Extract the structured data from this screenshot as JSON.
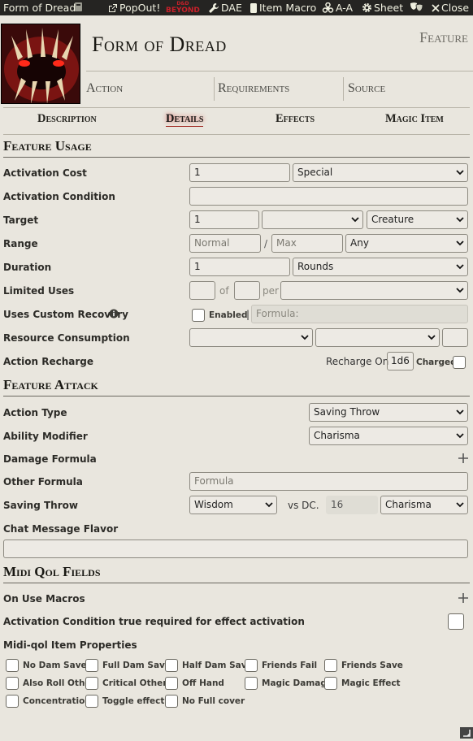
{
  "window": {
    "title": "Form of Dread",
    "buttons": {
      "popout": "PopOut!",
      "dndbeyond_top": "D&D",
      "dndbeyond_bottom": "BEYOND",
      "dae": "DAE",
      "item_macro": "Item Macro",
      "aa": "A-A",
      "sheet": "Sheet",
      "close": "Close"
    }
  },
  "header": {
    "name": "Form of Dread",
    "type": "Feature",
    "summary": {
      "action": "Action",
      "requirements": "Requirements",
      "source": "Source"
    }
  },
  "tabs": {
    "description": "Description",
    "details": "Details",
    "effects": "Effects",
    "magic_item": "Magic Item",
    "active": "details"
  },
  "feature_usage": {
    "heading": "Feature Usage",
    "activation_cost": {
      "label": "Activation Cost",
      "value": "1",
      "type": "Special"
    },
    "activation_condition": {
      "label": "Activation Condition",
      "value": ""
    },
    "target": {
      "label": "Target",
      "value": "1",
      "units": "",
      "type": "Creature"
    },
    "range": {
      "label": "Range",
      "normal_placeholder": "Normal",
      "separator": "/",
      "max_placeholder": "Max",
      "units": "Any"
    },
    "duration": {
      "label": "Duration",
      "value": "1",
      "units": "Rounds"
    },
    "limited_uses": {
      "label": "Limited Uses",
      "of": "of",
      "per": "per",
      "value": "",
      "max": "",
      "period": ""
    },
    "custom_recovery": {
      "label": "Uses Custom Recovery",
      "enabled": "Enabled",
      "separator": "|",
      "formula_label": "Formula:"
    },
    "resource_consumption": {
      "label": "Resource Consumption",
      "type": "",
      "target": "",
      "amount": ""
    },
    "action_recharge": {
      "label": "Action Recharge",
      "recharge_on": "Recharge On",
      "value": "1d6",
      "charged": "Charged"
    }
  },
  "feature_attack": {
    "heading": "Feature Attack",
    "action_type": {
      "label": "Action Type",
      "value": "Saving Throw"
    },
    "ability_modifier": {
      "label": "Ability Modifier",
      "value": "Charisma"
    },
    "damage_formula": {
      "label": "Damage Formula"
    },
    "other_formula": {
      "label": "Other Formula",
      "placeholder": "Formula"
    },
    "saving_throw": {
      "label": "Saving Throw",
      "ability": "Wisdom",
      "vs": "vs DC.",
      "dc": "16",
      "scaling": "Charisma"
    },
    "chat_flavor": {
      "label": "Chat Message Flavor",
      "value": ""
    }
  },
  "midi": {
    "heading": "Midi Qol Fields",
    "on_use_macros": "On Use Macros",
    "activation_condition": "Activation Condition true required for effect activation",
    "properties_label": "Midi-qol Item Properties",
    "properties": [
      "No Dam Save",
      "Full Dam Save",
      "Half Dam Save",
      "Friends Fail",
      "Friends Save",
      "Also Roll Other",
      "Critical Other",
      "Off Hand",
      "Magic Damage",
      "Magic Effect",
      "Concentration",
      "Toggle effect",
      "No Full cover"
    ]
  },
  "colors": {
    "titlebar": "#252422",
    "active_tab_underline": "#9b1b15",
    "background": "#e9e6de"
  }
}
